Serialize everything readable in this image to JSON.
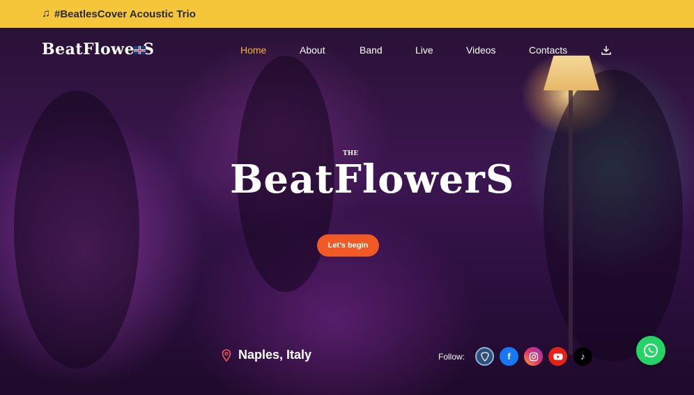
{
  "topbar": {
    "icon": "music-note-icon",
    "text": "#BeatlesCover Acoustic Trio"
  },
  "nav": {
    "logo": "BeatFlowerS",
    "language_flag": "uk-flag-icon",
    "items": [
      {
        "label": "Home",
        "active": true
      },
      {
        "label": "About",
        "active": false
      },
      {
        "label": "Band",
        "active": false
      },
      {
        "label": "Live",
        "active": false
      },
      {
        "label": "Videos",
        "active": false
      },
      {
        "label": "Contacts",
        "active": false
      }
    ],
    "download_icon": "download-icon"
  },
  "hero": {
    "the": "THE",
    "title": "BeatFlowerS",
    "cta_label": "Let's begin",
    "location": "Naples, Italy",
    "follow_label": "Follow:",
    "social": [
      "guitar-pick-icon",
      "facebook-icon",
      "instagram-icon",
      "youtube-icon",
      "tiktok-icon"
    ],
    "whatsapp_icon": "whatsapp-icon"
  },
  "colors": {
    "topbar": "#f5c53a",
    "accent": "#f7b733",
    "cta": "#f15a24",
    "whatsapp": "#25d366"
  }
}
